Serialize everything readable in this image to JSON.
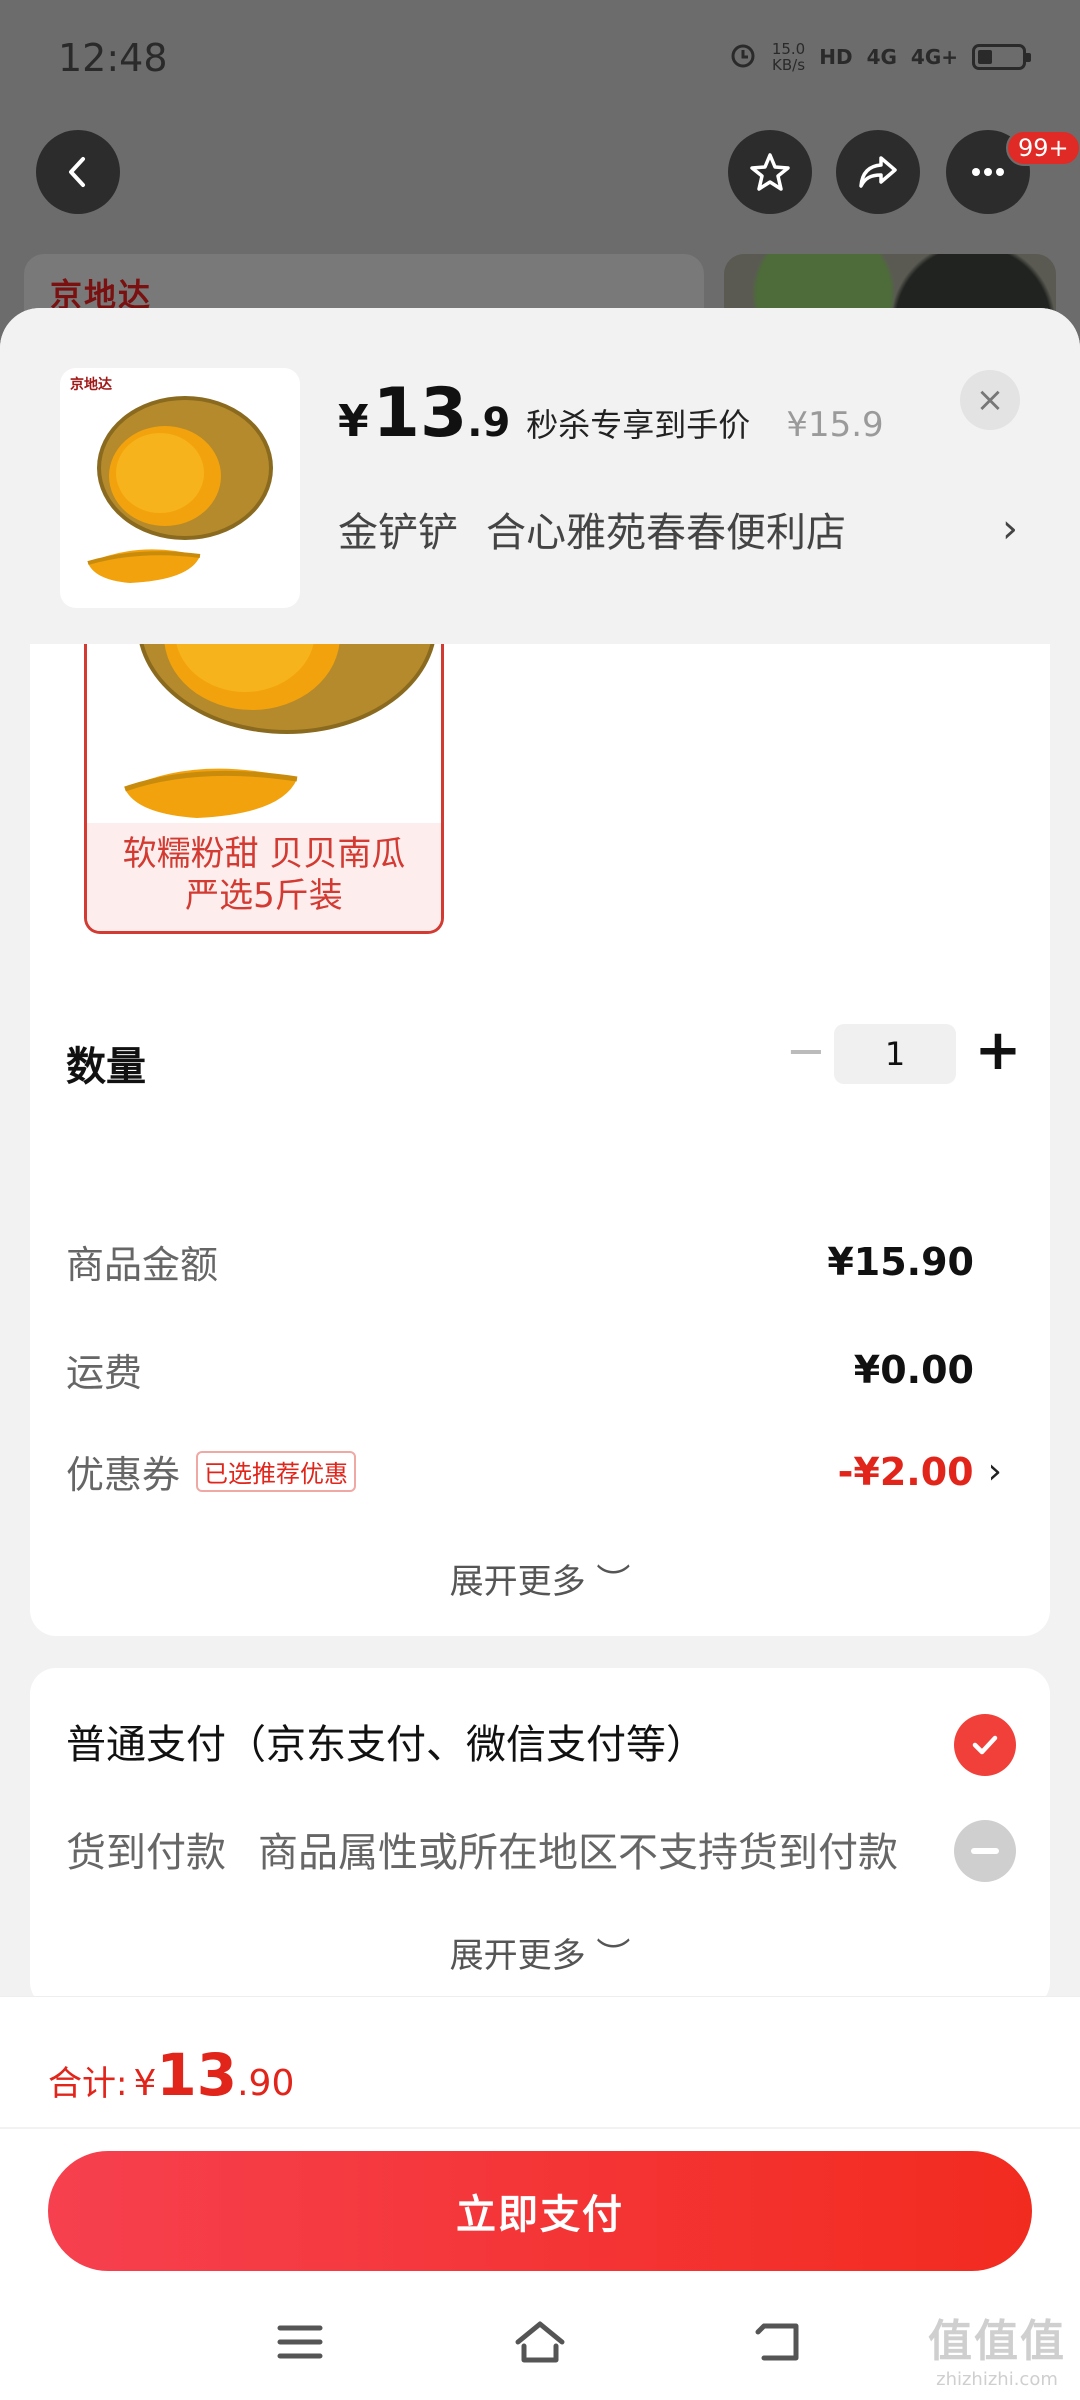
{
  "status_bar": {
    "time": "12:48",
    "net_speed_top": "15.0",
    "net_speed_unit": "KB/s",
    "hd": "HD",
    "sig1": "4G",
    "sig2": "4G+"
  },
  "background": {
    "more_badge": "99+",
    "shop_logo": "京地达"
  },
  "header": {
    "thumb_logo": "京地达",
    "price_symbol": "¥",
    "price_int": "13",
    "price_dec": ".9",
    "price_label": "秒杀专享到手价",
    "original_price": "¥15.9",
    "close": "×",
    "store_brand": "金铲铲",
    "store_name": "合心雅苑春春便利店",
    "store_arrow": "›"
  },
  "product": {
    "variant_label": "软糯粉甜 贝贝南瓜 严选5斤装",
    "quantity_label": "数量",
    "quantity_minus": "−",
    "quantity": "1",
    "quantity_plus": "+"
  },
  "amount": {
    "goods_label": "商品金额",
    "goods_value": "¥15.90",
    "shipping_label": "运费",
    "shipping_value": "¥0.00",
    "coupon_label": "优惠券",
    "coupon_tag": "已选推荐优惠",
    "coupon_value": "-¥2.00",
    "coupon_arrow": "›",
    "expand": "展开更多 ︶"
  },
  "payment": {
    "normal_label": "普通支付（京东支付、微信支付等）",
    "cod_label": "货到付款",
    "cod_desc": "商品属性或所在地区不支持货到付款",
    "expand": "展开更多 ︶"
  },
  "footer": {
    "total_label": "合计:",
    "total_symbol": "¥",
    "total_int": "13",
    "total_dec": ".90",
    "pay_button": "立即支付"
  },
  "watermark": {
    "big": "值值值",
    "small": "zhizhizhi.com"
  },
  "colors": {
    "accent_red": "#e1251b",
    "pay_gradient_start": "#f6404f",
    "pay_gradient_end": "#f22b1f"
  }
}
